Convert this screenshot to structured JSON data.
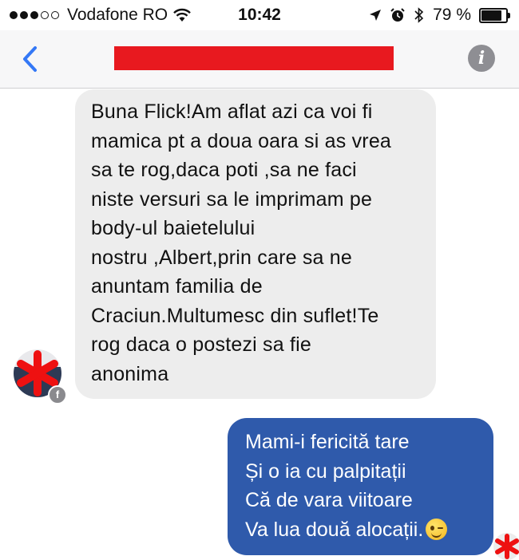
{
  "status_bar": {
    "carrier": "Vodafone RO",
    "time": "10:42",
    "battery": "79 %",
    "battery_level": 0.79,
    "signal_bars": 5,
    "signal_filled": 3,
    "icons": [
      "wifi-icon",
      "location-arrow-icon",
      "alarm-icon",
      "bluetooth-icon",
      "battery-icon"
    ]
  },
  "header": {
    "back_icon": "chevron-left-icon",
    "info_icon": "info-icon",
    "info_glyph": "i",
    "accent_color": "#3478f6",
    "redaction_color": "#e8191f"
  },
  "messages": [
    {
      "direction": "incoming",
      "bubble_color": "#ededed",
      "lines": [
        "Buna Flick!Am aflat azi ca voi fi",
        "mamica pt a doua oara si as vrea",
        "sa te rog,daca poti ,sa ne faci",
        "niste versuri sa le imprimam pe",
        "body-ul baietelului",
        "nostru ,Albert,prin care sa ne",
        "anuntam familia de",
        "Craciun.Multumesc din suflet!Te",
        "rog daca o postezi sa fie",
        "anonima"
      ]
    },
    {
      "direction": "outgoing",
      "bubble_color": "#2f5aab",
      "lines": [
        "Mami-i fericită tare",
        "Și o ia cu palpitații",
        "Că de vara viitoare",
        "Va lua două alocații."
      ],
      "emoji": "winking-face-emoji"
    }
  ],
  "sender_badge": "f"
}
